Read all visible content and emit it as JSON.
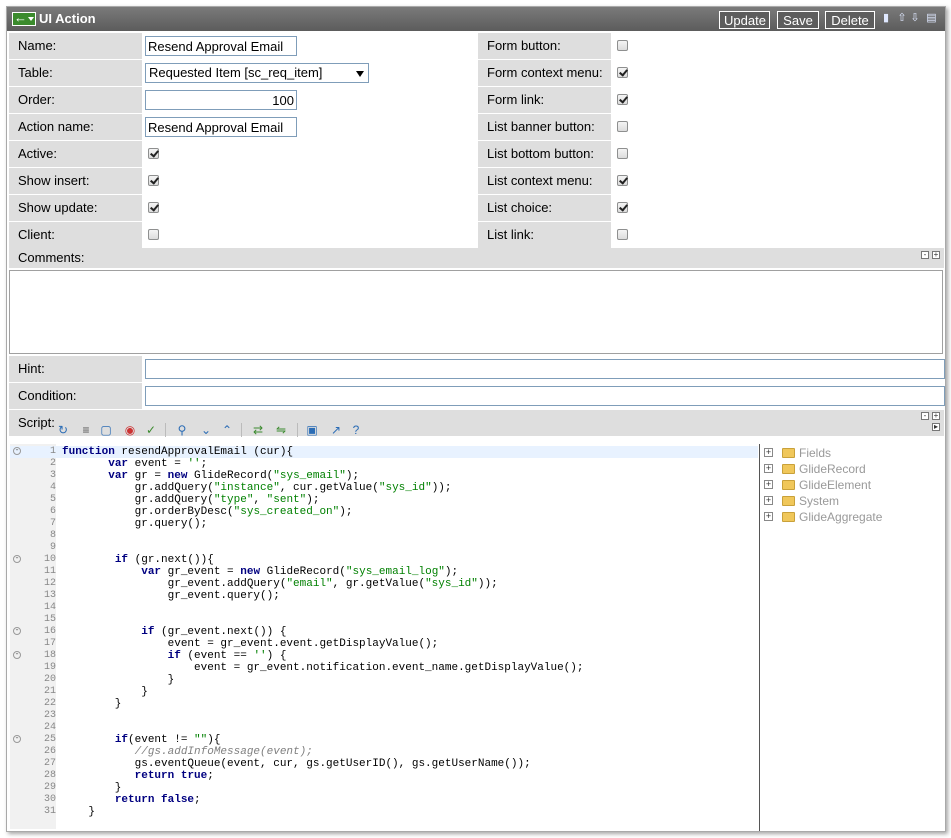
{
  "header": {
    "title": "UI Action",
    "update_label": "Update",
    "save_label": "Save",
    "delete_label": "Delete"
  },
  "form": {
    "name_label": "Name:",
    "name_value": "Resend Approval Email",
    "table_label": "Table:",
    "table_value": "Requested Item [sc_req_item]",
    "order_label": "Order:",
    "order_value": "100",
    "action_name_label": "Action name:",
    "action_name_value": "Resend Approval Email",
    "active_label": "Active:",
    "active_checked": true,
    "show_insert_label": "Show insert:",
    "show_insert_checked": true,
    "show_update_label": "Show update:",
    "show_update_checked": true,
    "client_label": "Client:",
    "client_checked": false,
    "form_button_label": "Form button:",
    "form_button_checked": false,
    "form_context_menu_label": "Form context menu:",
    "form_context_menu_checked": true,
    "form_link_label": "Form link:",
    "form_link_checked": true,
    "list_banner_button_label": "List banner button:",
    "list_banner_button_checked": false,
    "list_bottom_button_label": "List bottom button:",
    "list_bottom_button_checked": false,
    "list_context_menu_label": "List context menu:",
    "list_context_menu_checked": true,
    "list_choice_label": "List choice:",
    "list_choice_checked": true,
    "list_link_label": "List link:",
    "list_link_checked": false,
    "comments_label": "Comments:",
    "comments_value": "",
    "hint_label": "Hint:",
    "hint_value": "",
    "condition_label": "Condition:",
    "condition_value": ""
  },
  "script": {
    "label": "Script:",
    "lines": [
      {
        "n": "1",
        "code": "function resendApprovalEmail (cur){",
        "fold": true
      },
      {
        "n": "2",
        "code": "       var event = '';"
      },
      {
        "n": "3",
        "code": "       var gr = new GlideRecord(\"sys_email\");"
      },
      {
        "n": "4",
        "code": "           gr.addQuery(\"instance\", cur.getValue(\"sys_id\"));"
      },
      {
        "n": "5",
        "code": "           gr.addQuery(\"type\", \"sent\");"
      },
      {
        "n": "6",
        "code": "           gr.orderByDesc(\"sys_created_on\");"
      },
      {
        "n": "7",
        "code": "           gr.query();"
      },
      {
        "n": "8",
        "code": ""
      },
      {
        "n": "9",
        "code": ""
      },
      {
        "n": "10",
        "code": "        if (gr.next()){",
        "fold": true
      },
      {
        "n": "11",
        "code": "            var gr_event = new GlideRecord(\"sys_email_log\");"
      },
      {
        "n": "12",
        "code": "                gr_event.addQuery(\"email\", gr.getValue(\"sys_id\"));"
      },
      {
        "n": "13",
        "code": "                gr_event.query();"
      },
      {
        "n": "14",
        "code": ""
      },
      {
        "n": "15",
        "code": ""
      },
      {
        "n": "16",
        "code": "            if (gr_event.next()) {",
        "fold": true
      },
      {
        "n": "17",
        "code": "                event = gr_event.event.getDisplayValue();"
      },
      {
        "n": "18",
        "code": "                if (event == '') {",
        "fold": true
      },
      {
        "n": "19",
        "code": "                    event = gr_event.notification.event_name.getDisplayValue();"
      },
      {
        "n": "20",
        "code": "                }"
      },
      {
        "n": "21",
        "code": "            }"
      },
      {
        "n": "22",
        "code": "        }"
      },
      {
        "n": "23",
        "code": ""
      },
      {
        "n": "24",
        "code": ""
      },
      {
        "n": "25",
        "code": "        if(event != \"\"){",
        "fold": true
      },
      {
        "n": "26",
        "code": "           //gs.addInfoMessage(event);"
      },
      {
        "n": "27",
        "code": "           gs.eventQueue(event, cur, gs.getUserID(), gs.getUserName());"
      },
      {
        "n": "28",
        "code": "           return true;"
      },
      {
        "n": "29",
        "code": "        }"
      },
      {
        "n": "30",
        "code": "        return false;"
      },
      {
        "n": "31",
        "code": "    }"
      }
    ]
  },
  "tree": {
    "items": [
      "Fields",
      "GlideRecord",
      "GlideElement",
      "System",
      "GlideAggregate"
    ]
  }
}
